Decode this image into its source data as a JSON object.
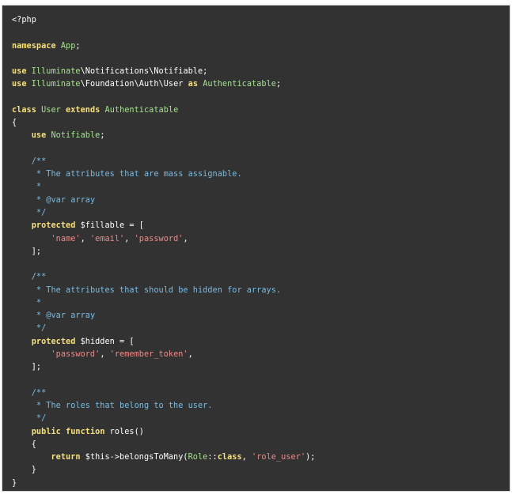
{
  "code": {
    "lines": [
      [
        {
          "t": "plain",
          "v": "<?php"
        }
      ],
      [],
      [
        {
          "t": "kw",
          "v": "namespace"
        },
        {
          "t": "plain",
          "v": " "
        },
        {
          "t": "cls",
          "v": "App"
        },
        {
          "t": "plain",
          "v": ";"
        }
      ],
      [],
      [
        {
          "t": "kw",
          "v": "use"
        },
        {
          "t": "plain",
          "v": " "
        },
        {
          "t": "cls",
          "v": "Illuminate"
        },
        {
          "t": "plain",
          "v": "\\Notifications\\Notifiable;"
        }
      ],
      [
        {
          "t": "kw",
          "v": "use"
        },
        {
          "t": "plain",
          "v": " "
        },
        {
          "t": "cls",
          "v": "Illuminate"
        },
        {
          "t": "plain",
          "v": "\\Foundation\\Auth\\User "
        },
        {
          "t": "kw",
          "v": "as"
        },
        {
          "t": "plain",
          "v": " "
        },
        {
          "t": "cls",
          "v": "Authenticatable"
        },
        {
          "t": "plain",
          "v": ";"
        }
      ],
      [],
      [
        {
          "t": "kw",
          "v": "class"
        },
        {
          "t": "plain",
          "v": " "
        },
        {
          "t": "cls",
          "v": "User"
        },
        {
          "t": "plain",
          "v": " "
        },
        {
          "t": "kw",
          "v": "extends"
        },
        {
          "t": "plain",
          "v": " "
        },
        {
          "t": "cls",
          "v": "Authenticatable"
        }
      ],
      [
        {
          "t": "plain",
          "v": "{"
        }
      ],
      [
        {
          "t": "plain",
          "v": "    "
        },
        {
          "t": "kw",
          "v": "use"
        },
        {
          "t": "plain",
          "v": " "
        },
        {
          "t": "cls",
          "v": "Notifiable"
        },
        {
          "t": "plain",
          "v": ";"
        }
      ],
      [],
      [
        {
          "t": "plain",
          "v": "    "
        },
        {
          "t": "cm",
          "v": "/**"
        }
      ],
      [
        {
          "t": "plain",
          "v": "     "
        },
        {
          "t": "cm",
          "v": "* The attributes that are mass assignable."
        }
      ],
      [
        {
          "t": "plain",
          "v": "     "
        },
        {
          "t": "cm",
          "v": "*"
        }
      ],
      [
        {
          "t": "plain",
          "v": "     "
        },
        {
          "t": "cm",
          "v": "* @var array"
        }
      ],
      [
        {
          "t": "plain",
          "v": "     "
        },
        {
          "t": "cm",
          "v": "*/"
        }
      ],
      [
        {
          "t": "plain",
          "v": "    "
        },
        {
          "t": "kw",
          "v": "protected"
        },
        {
          "t": "plain",
          "v": " $fillable = ["
        }
      ],
      [
        {
          "t": "plain",
          "v": "        "
        },
        {
          "t": "str",
          "v": "'name'"
        },
        {
          "t": "plain",
          "v": ", "
        },
        {
          "t": "str",
          "v": "'email'"
        },
        {
          "t": "plain",
          "v": ", "
        },
        {
          "t": "str",
          "v": "'password'"
        },
        {
          "t": "plain",
          "v": ","
        }
      ],
      [
        {
          "t": "plain",
          "v": "    ];"
        }
      ],
      [],
      [
        {
          "t": "plain",
          "v": "    "
        },
        {
          "t": "cm",
          "v": "/**"
        }
      ],
      [
        {
          "t": "plain",
          "v": "     "
        },
        {
          "t": "cm",
          "v": "* The attributes that should be hidden for arrays."
        }
      ],
      [
        {
          "t": "plain",
          "v": "     "
        },
        {
          "t": "cm",
          "v": "*"
        }
      ],
      [
        {
          "t": "plain",
          "v": "     "
        },
        {
          "t": "cm",
          "v": "* @var array"
        }
      ],
      [
        {
          "t": "plain",
          "v": "     "
        },
        {
          "t": "cm",
          "v": "*/"
        }
      ],
      [
        {
          "t": "plain",
          "v": "    "
        },
        {
          "t": "kw",
          "v": "protected"
        },
        {
          "t": "plain",
          "v": " $hidden = ["
        }
      ],
      [
        {
          "t": "plain",
          "v": "        "
        },
        {
          "t": "str",
          "v": "'password'"
        },
        {
          "t": "plain",
          "v": ", "
        },
        {
          "t": "str",
          "v": "'remember_token'"
        },
        {
          "t": "plain",
          "v": ","
        }
      ],
      [
        {
          "t": "plain",
          "v": "    ];"
        }
      ],
      [],
      [
        {
          "t": "plain",
          "v": "    "
        },
        {
          "t": "cm",
          "v": "/**"
        }
      ],
      [
        {
          "t": "plain",
          "v": "     "
        },
        {
          "t": "cm",
          "v": "* The roles that belong to the user."
        }
      ],
      [
        {
          "t": "plain",
          "v": "     "
        },
        {
          "t": "cm",
          "v": "*/"
        }
      ],
      [
        {
          "t": "plain",
          "v": "    "
        },
        {
          "t": "kw",
          "v": "public"
        },
        {
          "t": "plain",
          "v": " "
        },
        {
          "t": "kw",
          "v": "function"
        },
        {
          "t": "plain",
          "v": " roles()"
        }
      ],
      [
        {
          "t": "plain",
          "v": "    {"
        }
      ],
      [
        {
          "t": "plain",
          "v": "        "
        },
        {
          "t": "kw",
          "v": "return"
        },
        {
          "t": "plain",
          "v": " $this->belongsToMany("
        },
        {
          "t": "cls",
          "v": "Role"
        },
        {
          "t": "plain",
          "v": "::"
        },
        {
          "t": "kw",
          "v": "class"
        },
        {
          "t": "plain",
          "v": ", "
        },
        {
          "t": "str",
          "v": "'role_user'"
        },
        {
          "t": "plain",
          "v": ");"
        }
      ],
      [
        {
          "t": "plain",
          "v": "    }"
        }
      ],
      [
        {
          "t": "plain",
          "v": "}"
        }
      ]
    ]
  },
  "colors": {
    "background": "#323232",
    "keyword": "#f6e07a",
    "class_name": "#a6e28f",
    "comment": "#79bce5",
    "string": "#ef8a8a",
    "plain": "#ffffff"
  }
}
